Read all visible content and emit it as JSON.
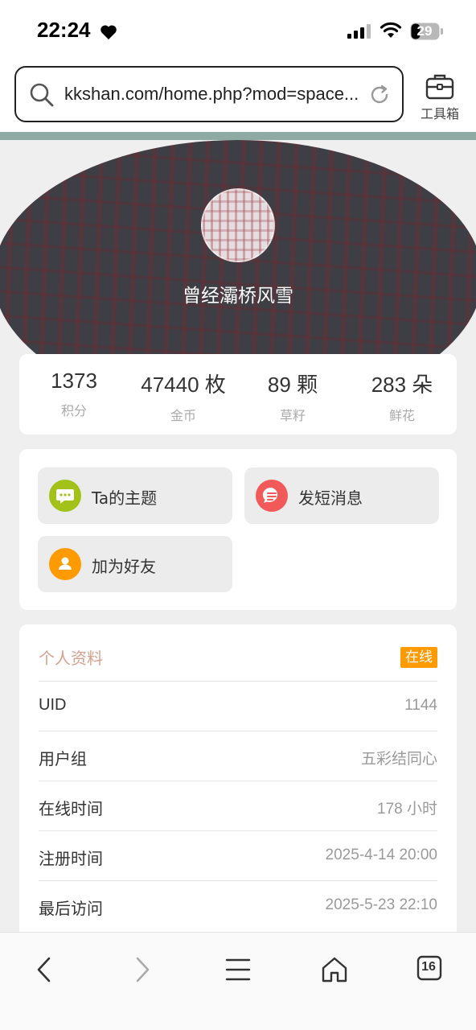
{
  "status_bar": {
    "time": "22:24",
    "battery_level": "29",
    "icons": [
      "heart-icon",
      "signal-icon",
      "wifi-icon",
      "battery-icon"
    ]
  },
  "browser": {
    "url": "kkshan.com/home.php?mod=space...",
    "toolbox_label": "工具箱",
    "icons": [
      "search-icon",
      "reload-icon",
      "toolbox-icon"
    ]
  },
  "profile": {
    "username": "曾经灞桥风雪"
  },
  "stats": [
    {
      "value": "1373",
      "label": "积分"
    },
    {
      "value": "47440 枚",
      "label": "金币"
    },
    {
      "value": "89 颗",
      "label": "草籽"
    },
    {
      "value": "283 朵",
      "label": "鲜花"
    }
  ],
  "actions": {
    "threads": {
      "label": "Ta的主题",
      "icon": "chat-bubble-icon",
      "color": "#a2c219"
    },
    "message": {
      "label": "发短消息",
      "icon": "message-icon",
      "color": "#f25a5a"
    },
    "add_friend": {
      "label": "加为好友",
      "icon": "user-icon",
      "color": "#ff9a00"
    }
  },
  "info": {
    "title": "个人资料",
    "badge": "在线",
    "rows": [
      {
        "label": "UID",
        "value": "1144"
      },
      {
        "label": "用户组",
        "value": "五彩结同心"
      },
      {
        "label": "在线时间",
        "value": "178 小时"
      },
      {
        "label": "注册时间",
        "value": "2025-4-14 20:00"
      },
      {
        "label": "最后访问",
        "value": "2025-5-23 22:10"
      }
    ]
  },
  "bottom_nav": {
    "tab_count": "16",
    "icons": [
      "back-icon",
      "forward-icon",
      "menu-icon",
      "home-icon",
      "tabs-icon"
    ]
  },
  "colors": {
    "accent_strip": "#8eaaa2",
    "info_title": "#d6a08e",
    "online_badge": "#ff9a00"
  }
}
